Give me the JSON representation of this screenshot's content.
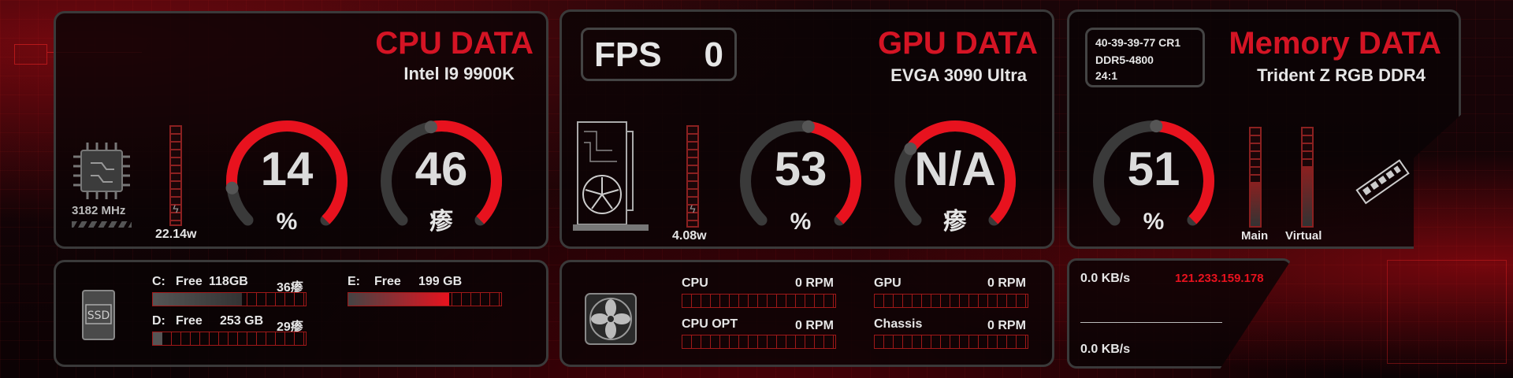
{
  "cpu": {
    "title": "CPU DATA",
    "model": "Intel I9 9900K",
    "freq": "3182 MHz",
    "power": "22.14w",
    "load": "14",
    "load_unit": "%",
    "temp": "46",
    "temp_unit": "瘆",
    "load_pct": 14,
    "temp_pct": 46
  },
  "gpu": {
    "title": "GPU DATA",
    "model": "EVGA 3090 Ultra",
    "fps_label": "FPS",
    "fps_value": "0",
    "power": "4.08w",
    "load": "53",
    "load_unit": "%",
    "temp": "N/A",
    "temp_unit": "瘆",
    "load_pct": 53
  },
  "memory": {
    "title": "Memory DATA",
    "model": "Trident Z RGB DDR4",
    "timing": "40-39-39-77 CR1",
    "speed": "DDR5-4800",
    "ratio": "24:1",
    "load": "51",
    "load_unit": "%",
    "main_label": "Main",
    "virtual_label": "Virtual",
    "load_pct": 51
  },
  "storage": {
    "c": {
      "label": "C:",
      "free_label": "Free",
      "free": "118GB",
      "temp": "36瘆"
    },
    "d": {
      "label": "D:",
      "free_label": "Free",
      "free": "253 GB",
      "temp": "29瘆"
    },
    "e": {
      "label": "E:",
      "free_label": "Free",
      "free": "199 GB"
    }
  },
  "fans": {
    "cpu": {
      "label": "CPU",
      "value": "0 RPM"
    },
    "gpu": {
      "label": "GPU",
      "value": "0 RPM"
    },
    "cpu_opt": {
      "label": "CPU OPT",
      "value": "0 RPM"
    },
    "chassis": {
      "label": "Chassis",
      "value": "0 RPM"
    }
  },
  "network": {
    "upload": "0.0 KB/s",
    "download": "0.0 KB/s",
    "ip": "121.233.159.178"
  },
  "colors": {
    "accent": "#e8121e",
    "title_red": "#d41424",
    "panel_border": "#3a3a3a"
  }
}
